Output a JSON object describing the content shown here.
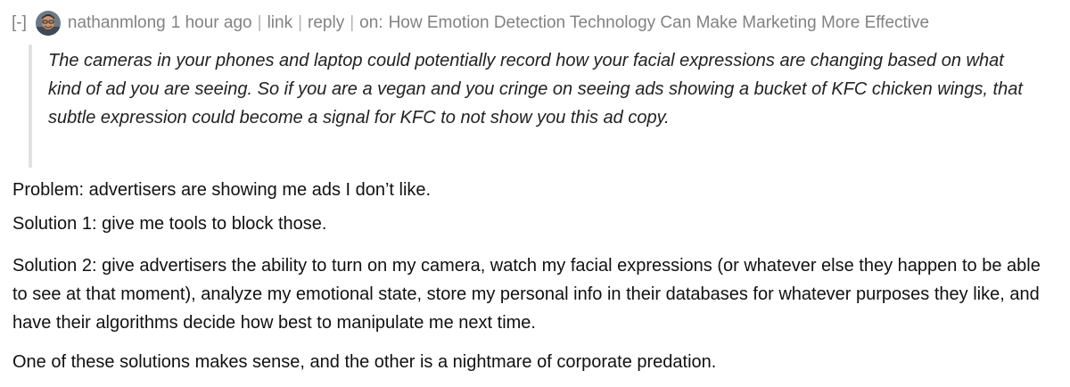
{
  "comment": {
    "toggle_label": "[-]",
    "author": "nathanmlong",
    "age": "1 hour ago",
    "separator": "|",
    "link_label": "link",
    "reply_label": "reply",
    "on_prefix": "on:",
    "story_title": "How Emotion Detection Technology Can Make Marketing More Effective",
    "quote": "The cameras in your phones and laptop could potentially record how your facial expressions are changing based on what kind of ad you are seeing. So if you are a vegan and you cringe on seeing ads showing a bucket of KFC chicken wings, that subtle expression could become a signal for KFC to not show you this ad copy.",
    "paragraphs": [
      "Problem: advertisers are showing me ads I don’t like.",
      "Solution 1: give me tools to block those.",
      "Solution 2: give advertisers the ability to turn on my camera, watch my facial expressions (or whatever else they happen to be able to see at that moment), analyze my emotional state, store my personal info in their databases for whatever purposes they like, and have their algorithms decide how best to manipulate me next time.",
      "One of these solutions makes sense, and the other is a nightmare of corporate predation."
    ]
  },
  "colors": {
    "meta_text": "#828282",
    "quote_bar": "#e2e2e2",
    "body_text": "#111111"
  }
}
